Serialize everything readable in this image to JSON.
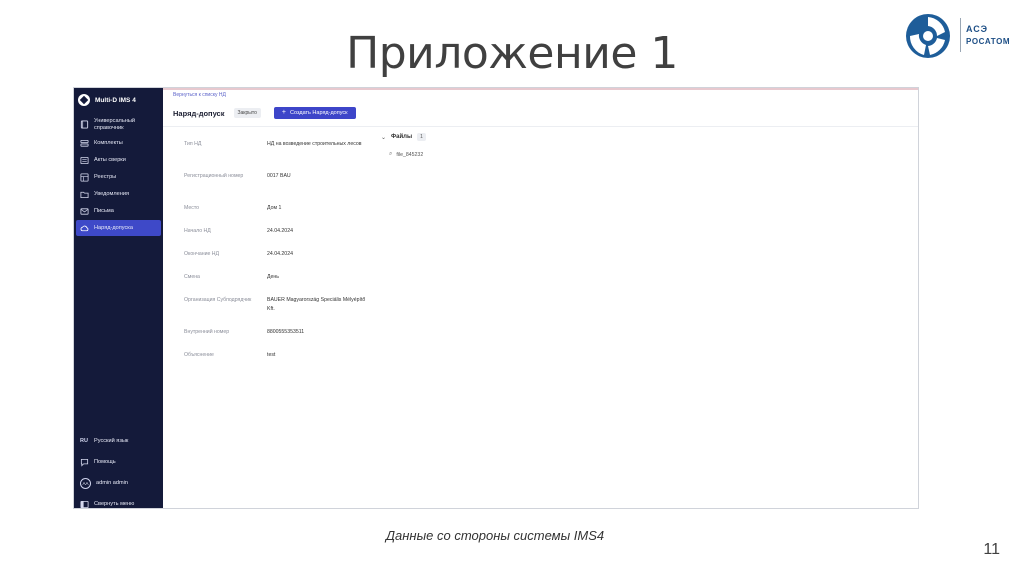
{
  "slide": {
    "title": "Приложение 1",
    "caption": "Данные со стороны системы IMS4",
    "page_number": "11",
    "logo": {
      "line1": "АСЭ",
      "line2": "РОСАТОМ"
    }
  },
  "app": {
    "name": "Multi-D IMS 4",
    "sidebar": {
      "items": [
        {
          "label": "Универсальный справочник",
          "icon": "book-icon"
        },
        {
          "label": "Комплекты",
          "icon": "stack-icon"
        },
        {
          "label": "Акты сверки",
          "icon": "document-icon"
        },
        {
          "label": "Реестры",
          "icon": "table-icon"
        },
        {
          "label": "Уведомления",
          "icon": "folder-icon"
        },
        {
          "label": "Письма",
          "icon": "mail-icon"
        },
        {
          "label": "Наряд-допуска",
          "icon": "cloud-icon"
        }
      ],
      "active": "Наряд-допуска",
      "bottom": {
        "language_code": "RU",
        "language": "Русский язык",
        "help": "Помощь",
        "avatar_initials": "AA",
        "user": "admin admin",
        "collapse": "Свернуть меню"
      }
    },
    "main": {
      "back_link": "Вернуться к списку НД",
      "title": "Наряд-допуск",
      "status": "Закрыто",
      "create_button": "Создать Наряд-допуск",
      "fields": [
        {
          "label": "Тип НД",
          "value": "НД на возведение строительных лесов"
        },
        {
          "label": "Регистрационный номер",
          "value": "0017 BAU"
        },
        {
          "label": "Место",
          "value": "Дом 1"
        },
        {
          "label": "Начало НД",
          "value": "24.04.2024"
        },
        {
          "label": "Окончание НД",
          "value": "24.04.2024"
        },
        {
          "label": "Смена",
          "value": "День"
        },
        {
          "label": "Организация Субподрядчик",
          "value": "BAUER Magyarország Speciális Mélyépítő Kft."
        },
        {
          "label": "Внутренний номер",
          "value": "8800555353511"
        },
        {
          "label": "Объяснение",
          "value": "test"
        }
      ],
      "files": {
        "title": "Файлы",
        "count": "1",
        "items": [
          "file_845232"
        ]
      }
    }
  }
}
